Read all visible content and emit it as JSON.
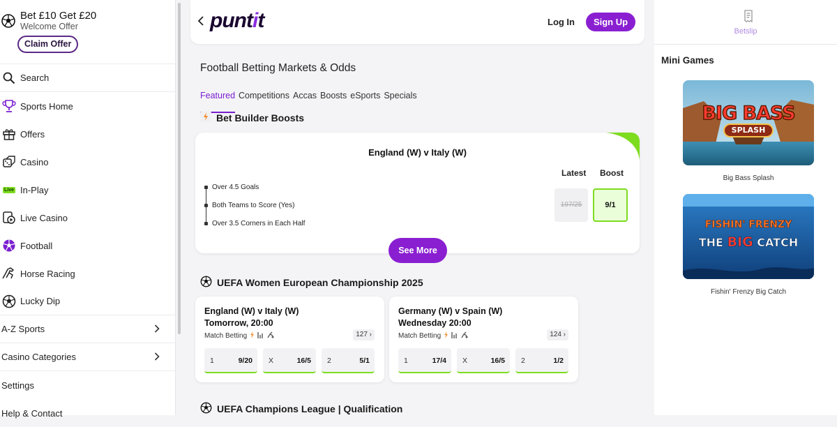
{
  "promo": {
    "title": "Bet £10 Get £20",
    "subtitle": "Welcome Offer",
    "cta": "Claim Offer"
  },
  "nav": [
    {
      "label": "Search",
      "icon": "search-icon"
    },
    {
      "label": "Sports Home",
      "icon": "trophy-icon"
    },
    {
      "label": "Offers",
      "icon": "gift-icon"
    },
    {
      "label": "Casino",
      "icon": "dice-icon"
    },
    {
      "label": "In-Play",
      "icon": "live-badge",
      "badge": "Live"
    },
    {
      "label": "Live Casino",
      "icon": "live-casino-icon"
    },
    {
      "label": "Football",
      "icon": "football-icon"
    },
    {
      "label": "Horse Racing",
      "icon": "horse-icon"
    },
    {
      "label": "Lucky Dip",
      "icon": "lucky-dip-icon"
    },
    {
      "label": "A-Z Sports"
    },
    {
      "label": "Casino Categories"
    },
    {
      "label": "Settings"
    },
    {
      "label": "Help & Contact"
    }
  ],
  "header": {
    "logo": "puntit",
    "login": "Log In",
    "signup": "Sign Up"
  },
  "page": {
    "title": "Football Betting Markets & Odds",
    "tabs": [
      "Featured",
      "Competitions",
      "Accas",
      "Boosts",
      "eSports",
      "Specials"
    ]
  },
  "boosts": {
    "section": "Bet Builder Boosts",
    "match": "England (W) v Italy (W)",
    "latest_label": "Latest",
    "boost_label": "Boost",
    "legs": [
      "Over 4.5 Goals",
      "Both Teams to Score (Yes)",
      "Over 3.5 Corners in Each Half"
    ],
    "latest_odds": "197/25",
    "boost_odds": "9/1",
    "see_more": "See More"
  },
  "competition1": {
    "title": "UEFA Women European Championship 2025",
    "matches": [
      {
        "teams": "England (W) v Italy (W)",
        "time": "Tomorrow, 20:00",
        "market": "Match Betting",
        "count": "127",
        "odds": [
          [
            "1",
            "9/20"
          ],
          [
            "X",
            "16/5"
          ],
          [
            "2",
            "5/1"
          ]
        ]
      },
      {
        "teams": "Germany (W) v Spain (W)",
        "time": "Wednesday 20:00",
        "market": "Match Betting",
        "count": "124",
        "odds": [
          [
            "1",
            "17/4"
          ],
          [
            "X",
            "16/5"
          ],
          [
            "2",
            "1/2"
          ]
        ]
      }
    ]
  },
  "competition2": {
    "title": "UEFA Champions League | Qualification"
  },
  "betslip": {
    "label": "Betslip"
  },
  "mini_games": {
    "title": "Mini Games",
    "games": [
      {
        "name": "Big Bass Splash",
        "logo_line1": "BIG BASS",
        "logo_line2": "SPLASH"
      },
      {
        "name": "Fishin' Frenzy Big Catch",
        "logo_line1": "FISHIN' FRENZY",
        "logo_line2": "THE",
        "logo_line3": "BIG",
        "logo_line4": "CATCH"
      }
    ]
  },
  "colors": {
    "brand": "#8a1fd1",
    "accent_green": "#7ddc1f"
  }
}
